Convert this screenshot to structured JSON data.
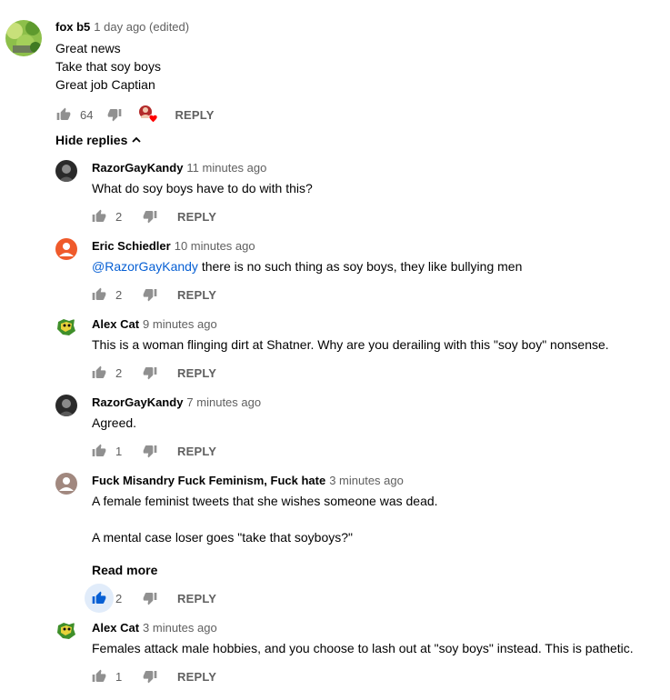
{
  "main": {
    "author": "fox b5",
    "time": "1 day ago (edited)",
    "lines": [
      "Great news",
      "Take that soy boys",
      "Great job Captian"
    ],
    "likes": "64",
    "reply_label": "REPLY"
  },
  "hide_replies_label": "Hide replies",
  "replies": [
    {
      "author": "RazorGayKandy",
      "time": "11 minutes ago",
      "text": "What do soy boys have to do with this?",
      "likes": "2",
      "reply_label": "REPLY"
    },
    {
      "author": "Eric Schiedler",
      "time": "10 minutes ago",
      "mention": "@RazorGayKandy",
      "text": " there is no such thing as soy boys, they like bullying men",
      "likes": "2",
      "reply_label": "REPLY"
    },
    {
      "author": "Alex Cat",
      "time": "9 minutes ago",
      "text": "This is a woman flinging dirt at Shatner. Why are you derailing with this \"soy boy\" nonsense.",
      "likes": "2",
      "reply_label": "REPLY"
    },
    {
      "author": "RazorGayKandy",
      "time": "7 minutes ago",
      "text": "Agreed.",
      "likes": "1",
      "reply_label": "REPLY"
    },
    {
      "author": "Fuck Misandry Fuck Feminism, Fuck hate",
      "time": "3 minutes ago",
      "text": "A female feminist tweets that she wishes someone was dead.",
      "text2": "A mental case loser goes \"take that soyboys?\"",
      "read_more": "Read more",
      "likes": "2",
      "reply_label": "REPLY"
    },
    {
      "author": "Alex Cat",
      "time": "3 minutes ago",
      "text": "Females attack male hobbies, and you choose to lash out at \"soy boys\" instead. This is pathetic.",
      "likes": "1",
      "reply_label": "REPLY"
    }
  ],
  "colors": {
    "link": "#065fd4",
    "liked": "#065fd4",
    "muted": "#606060",
    "eric_avatar": "#ef5a2b"
  },
  "icons": {
    "like": "thumb-up-icon",
    "dislike": "thumb-down-icon",
    "creator_heart": "heart-icon",
    "collapse": "chevron-up-icon"
  }
}
